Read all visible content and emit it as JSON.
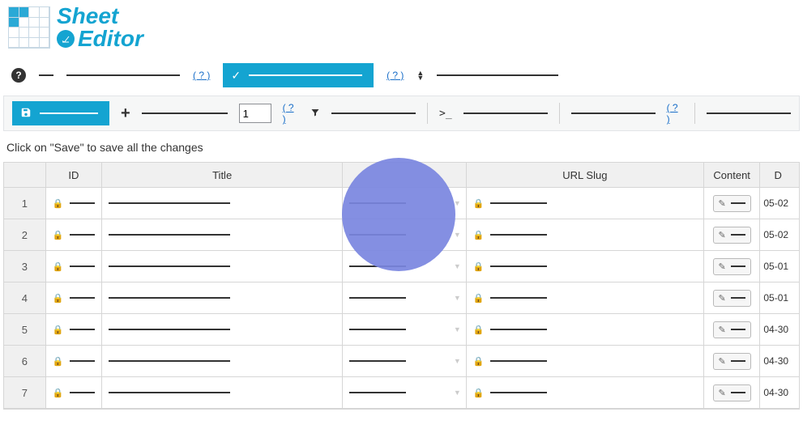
{
  "logo": {
    "line1": "Sheet",
    "line2": "Editor"
  },
  "top": {
    "help1": "( ? )",
    "help2": "( ? )"
  },
  "toolbar": {
    "page_value": "1",
    "help1": "( ? )",
    "help2": "( ? )",
    "console_prefix": ">_"
  },
  "hint": "Click on \"Save\" to save all the changes",
  "grid": {
    "headers": {
      "id": "ID",
      "title": "Title",
      "slug": "URL Slug",
      "content": "Content",
      "date": "D"
    },
    "rows": [
      {
        "num": "1",
        "date": "05-02"
      },
      {
        "num": "2",
        "date": "05-02"
      },
      {
        "num": "3",
        "date": "05-01"
      },
      {
        "num": "4",
        "date": "05-01"
      },
      {
        "num": "5",
        "date": "04-30"
      },
      {
        "num": "6",
        "date": "04-30"
      },
      {
        "num": "7",
        "date": "04-30"
      }
    ]
  }
}
